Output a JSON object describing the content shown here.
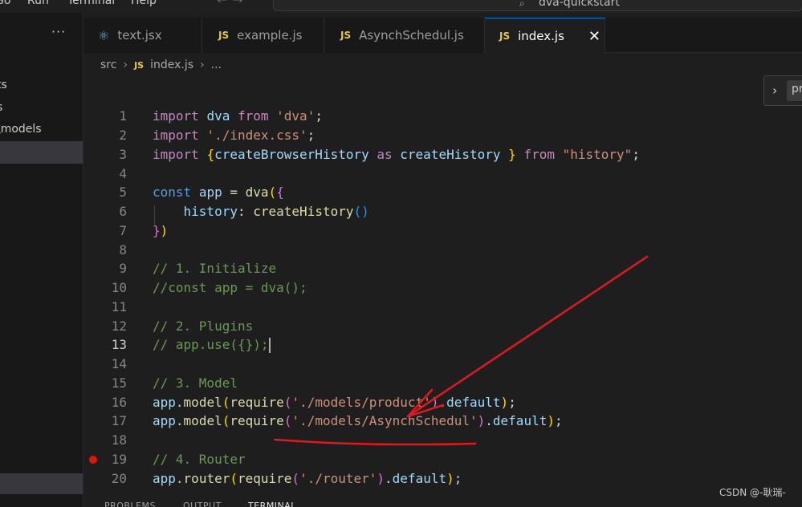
{
  "titlebar": {
    "menu": [
      "Go",
      "Run",
      "Terminal",
      "Help"
    ],
    "command_center": "dva-quickstart"
  },
  "sidebar": {
    "more_label": "···",
    "items": [
      "ts",
      "s",
      "\\models"
    ]
  },
  "tabs": [
    {
      "icon": "react-icon",
      "label": "text.jsx",
      "active": false
    },
    {
      "icon": "js",
      "label": "example.js",
      "active": false
    },
    {
      "icon": "js",
      "label": "AsynchSchedul.js",
      "active": false
    },
    {
      "icon": "js",
      "label": "index.js",
      "active": true
    }
  ],
  "js_badge": "JS",
  "close_glyph": "✕",
  "breadcrumb": {
    "folder": "src",
    "file": "index.js",
    "more": "..."
  },
  "editor": {
    "current_line": 13,
    "breakpoint_line": 19,
    "lines": [
      {
        "n": "1",
        "text": "import dva from 'dva';"
      },
      {
        "n": "2",
        "text": "import './index.css';"
      },
      {
        "n": "3",
        "text": "import {createBrowserHistory as createHistory } from \"history\";"
      },
      {
        "n": "4",
        "text": ""
      },
      {
        "n": "5",
        "text": "const app = dva({"
      },
      {
        "n": "6",
        "text": "    history: createHistory()"
      },
      {
        "n": "7",
        "text": "})"
      },
      {
        "n": "8",
        "text": ""
      },
      {
        "n": "9",
        "text": "// 1. Initialize"
      },
      {
        "n": "10",
        "text": "//const app = dva();"
      },
      {
        "n": "11",
        "text": ""
      },
      {
        "n": "12",
        "text": "// 2. Plugins"
      },
      {
        "n": "13",
        "text": "// app.use({});"
      },
      {
        "n": "14",
        "text": ""
      },
      {
        "n": "15",
        "text": "// 3. Model"
      },
      {
        "n": "16",
        "text": "app.model(require('./models/product').default);"
      },
      {
        "n": "17",
        "text": "app.model(require('./models/AsynchSchedul').default);"
      },
      {
        "n": "18",
        "text": ""
      },
      {
        "n": "19",
        "text": "// 4. Router"
      },
      {
        "n": "20",
        "text": "app.router(require('./router').default);"
      }
    ]
  },
  "sticky_widget": {
    "label": "pr"
  },
  "panel_tabs": [
    "PROBLEMS",
    "OUTPUT",
    "TERMINAL"
  ],
  "watermark": "CSDN @-耿瑞-",
  "colors": {
    "keyword": "#c586c0",
    "string": "#ce9178",
    "variable": "#9cdcfe",
    "comment": "#6a9955",
    "function": "#dcdcaa",
    "declaration": "#569cd6",
    "annotation_red": "#e0191e",
    "breakpoint": "#e51400"
  }
}
